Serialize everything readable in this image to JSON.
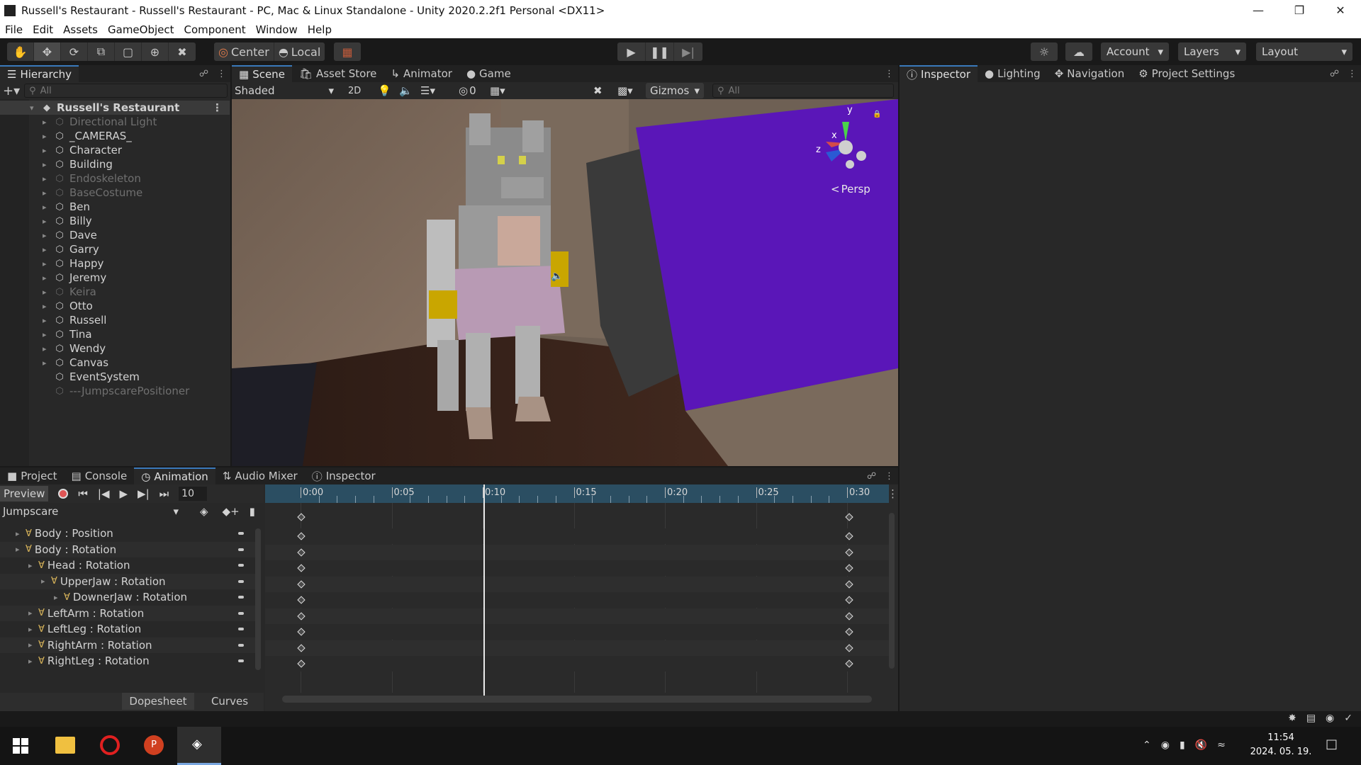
{
  "window": {
    "title": "Russell's Restaurant - Russell's Restaurant - PC, Mac & Linux Standalone - Unity 2020.2.2f1 Personal <DX11>"
  },
  "menu": [
    "File",
    "Edit",
    "Assets",
    "GameObject",
    "Component",
    "Window",
    "Help"
  ],
  "toolbar": {
    "pivot": "Center",
    "space": "Local",
    "account": "Account",
    "layers": "Layers",
    "layout": "Layout"
  },
  "hierarchy": {
    "tab": "Hierarchy",
    "search_placeholder": "All",
    "scene": "Russell's Restaurant",
    "items": [
      {
        "label": "Directional Light",
        "disabled": true,
        "arrow": true
      },
      {
        "label": "_CAMERAS_",
        "disabled": false,
        "arrow": true
      },
      {
        "label": "Character",
        "disabled": false,
        "arrow": true
      },
      {
        "label": "Building",
        "disabled": false,
        "arrow": true
      },
      {
        "label": "Endoskeleton",
        "disabled": true,
        "arrow": true
      },
      {
        "label": "BaseCostume",
        "disabled": true,
        "arrow": true
      },
      {
        "label": "Ben",
        "disabled": false,
        "arrow": true
      },
      {
        "label": "Billy",
        "disabled": false,
        "arrow": true
      },
      {
        "label": "Dave",
        "disabled": false,
        "arrow": true
      },
      {
        "label": "Garry",
        "disabled": false,
        "arrow": true
      },
      {
        "label": "Happy",
        "disabled": false,
        "arrow": true
      },
      {
        "label": "Jeremy",
        "disabled": false,
        "arrow": true
      },
      {
        "label": "Keira",
        "disabled": true,
        "arrow": true
      },
      {
        "label": "Otto",
        "disabled": false,
        "arrow": true
      },
      {
        "label": "Russell",
        "disabled": false,
        "arrow": true
      },
      {
        "label": "Tina",
        "disabled": false,
        "arrow": true
      },
      {
        "label": "Wendy",
        "disabled": false,
        "arrow": true
      },
      {
        "label": "Canvas",
        "disabled": false,
        "arrow": true
      },
      {
        "label": "EventSystem",
        "disabled": false,
        "arrow": false
      },
      {
        "label": "---JumpscarePositioner",
        "disabled": true,
        "arrow": false
      }
    ]
  },
  "scene_tabs": [
    "Scene",
    "Asset Store",
    "Animator",
    "Game"
  ],
  "scene_toolbar": {
    "shading": "Shaded",
    "mode2d": "2D",
    "hidden_count": "0",
    "gizmos": "Gizmos",
    "search_placeholder": "All",
    "persp": "Persp",
    "axis_x": "x",
    "axis_y": "y",
    "axis_z": "z"
  },
  "inspector_tabs": [
    "Inspector",
    "Lighting",
    "Navigation",
    "Project Settings"
  ],
  "bottom_tabs": [
    "Project",
    "Console",
    "Animation",
    "Audio Mixer",
    "Inspector"
  ],
  "animation": {
    "preview": "Preview",
    "frame": "10",
    "clip": "Jumpscare",
    "time_labels": [
      "0:00",
      "0:05",
      "0:10",
      "0:15",
      "0:20",
      "0:25",
      "0:30"
    ],
    "properties": [
      {
        "label": "Body : Position",
        "indent": 0
      },
      {
        "label": "Body : Rotation",
        "indent": 0
      },
      {
        "label": "Head : Rotation",
        "indent": 1
      },
      {
        "label": "UpperJaw : Rotation",
        "indent": 2
      },
      {
        "label": "DownerJaw : Rotation",
        "indent": 3
      },
      {
        "label": "LeftArm : Rotation",
        "indent": 1
      },
      {
        "label": "LeftLeg : Rotation",
        "indent": 1
      },
      {
        "label": "RightArm : Rotation",
        "indent": 1
      },
      {
        "label": "RightLeg : Rotation",
        "indent": 1
      }
    ],
    "dopesheet": "Dopesheet",
    "curves": "Curves"
  },
  "taskbar": {
    "time": "11:54",
    "date": "2024. 05. 19."
  },
  "colors": {
    "accent": "#3a79bb",
    "timeline_header": "#2b4e62",
    "record": "#e05555",
    "purple_wall": "#5a16b8"
  }
}
